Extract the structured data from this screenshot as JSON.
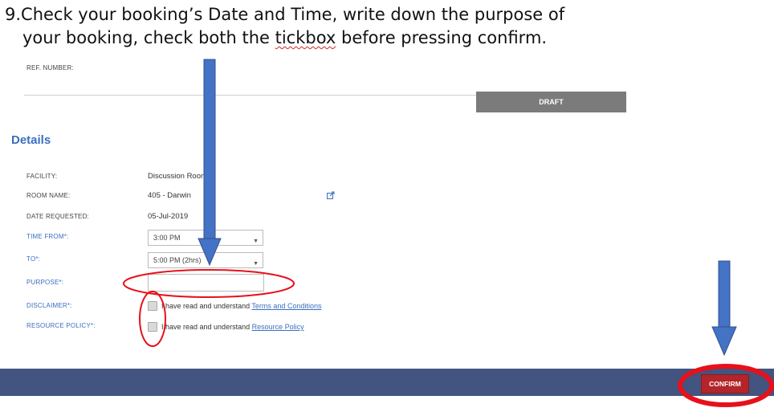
{
  "instruction": {
    "line1": "9.Check your booking’s Date and Time, write down the purpose of",
    "line2_pre": "your booking, check both the ",
    "line2_word": "tickbox",
    "line2_post": " before pressing confirm."
  },
  "ref_label": "REF. NUMBER:",
  "status_badge": "DRAFT",
  "details_title": "Details",
  "fields": {
    "facility": {
      "label": "FACILITY:",
      "value": "Discussion Room"
    },
    "room": {
      "label": "ROOM NAME:",
      "value": "405 - Darwin"
    },
    "date": {
      "label": "DATE REQUESTED:",
      "value": "05-Jul-2019"
    },
    "time_from": {
      "label": "TIME FROM*:",
      "value": "3:00 PM"
    },
    "time_to": {
      "label": "TO*:",
      "value": "5:00 PM (2hrs)"
    },
    "purpose": {
      "label": "PURPOSE*:",
      "value": ""
    },
    "disclaimer": {
      "label": "DISCLAIMER*:",
      "text": "I have read and understand ",
      "link": "Terms and Conditions"
    },
    "resource_policy": {
      "label": "RESOURCE POLICY*:",
      "text": "I have read and understand ",
      "link": "Resource Policy"
    }
  },
  "confirm_label": "CONFIRM",
  "colors": {
    "accent_blue": "#3a6fbf",
    "footer": "#42547f",
    "confirm": "#b3252a",
    "annotation_red": "#e8101a",
    "arrow_blue": "#4472c4"
  },
  "icons": {
    "external_link": "external-link-icon"
  }
}
